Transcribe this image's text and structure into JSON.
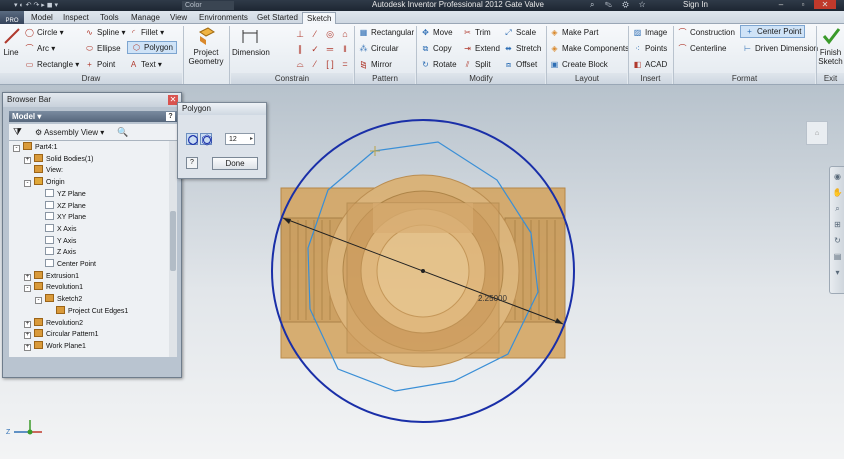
{
  "title_bar": {
    "title": "Autodesk Inventor Professional 2012   Gate Valve",
    "color_box": "Color",
    "sign_in": "Sign In"
  },
  "app_button": "PRO",
  "tabs": [
    "Model",
    "Inspect",
    "Tools",
    "Manage",
    "View",
    "Environments",
    "Get Started",
    "Sketch"
  ],
  "active_tab": "Sketch",
  "ribbon": {
    "draw": {
      "label": "Draw",
      "line": "Line",
      "circle": "Circle",
      "arc": "Arc",
      "rectangle": "Rectangle",
      "spline": "Spline",
      "ellipse": "Ellipse",
      "point": "Point",
      "fillet": "Fillet",
      "polygon": "Polygon",
      "text": "Text"
    },
    "project_geometry": "Project Geometry",
    "constrain": {
      "label": "Constrain",
      "dimension": "Dimension"
    },
    "pattern": {
      "label": "Pattern",
      "rectangular": "Rectangular",
      "circular": "Circular",
      "mirror": "Mirror"
    },
    "modify": {
      "label": "Modify",
      "move": "Move",
      "trim": "Trim",
      "scale": "Scale",
      "copy": "Copy",
      "extend": "Extend",
      "stretch": "Stretch",
      "rotate": "Rotate",
      "split": "Split",
      "offset": "Offset"
    },
    "layout": {
      "label": "Layout",
      "make_part": "Make Part",
      "make_components": "Make Components",
      "create_block": "Create Block"
    },
    "insert": {
      "label": "Insert",
      "image": "Image",
      "points": "Points",
      "acad": "ACAD"
    },
    "format": {
      "label": "Format",
      "construction": "Construction",
      "center_point": "Center Point",
      "centerline": "Centerline",
      "driven_dimension": "Driven Dimension"
    },
    "exit": {
      "label": "Exit",
      "finish_sketch": "Finish Sketch"
    }
  },
  "browser_bar": {
    "title": "Browser Bar",
    "model_label": "Model",
    "view_label": "Assembly View",
    "tree": [
      {
        "label": "Part4:1",
        "depth": 0,
        "expander": "-"
      },
      {
        "label": "Solid Bodies(1)",
        "depth": 1,
        "expander": "+"
      },
      {
        "label": "View:",
        "depth": 1,
        "expander": ""
      },
      {
        "label": "Origin",
        "depth": 1,
        "expander": "-"
      },
      {
        "label": "YZ Plane",
        "depth": 2,
        "expander": ""
      },
      {
        "label": "XZ Plane",
        "depth": 2,
        "expander": ""
      },
      {
        "label": "XY Plane",
        "depth": 2,
        "expander": ""
      },
      {
        "label": "X Axis",
        "depth": 2,
        "expander": ""
      },
      {
        "label": "Y Axis",
        "depth": 2,
        "expander": ""
      },
      {
        "label": "Z Axis",
        "depth": 2,
        "expander": ""
      },
      {
        "label": "Center Point",
        "depth": 2,
        "expander": ""
      },
      {
        "label": "Extrusion1",
        "depth": 1,
        "expander": "+"
      },
      {
        "label": "Revolution1",
        "depth": 1,
        "expander": "-"
      },
      {
        "label": "Sketch2",
        "depth": 2,
        "expander": "-"
      },
      {
        "label": "Project Cut Edges1",
        "depth": 3,
        "expander": ""
      },
      {
        "label": "Revolution2",
        "depth": 1,
        "expander": "+"
      },
      {
        "label": "Circular Pattern1",
        "depth": 1,
        "expander": "+"
      },
      {
        "label": "Work Plane1",
        "depth": 1,
        "expander": "+"
      }
    ]
  },
  "polygon_dialog": {
    "title": "Polygon",
    "sides": "12",
    "help_label": "?",
    "done_label": "Done"
  },
  "sketch": {
    "dimension_label": "2.25000"
  },
  "colors": {
    "circle": "#1a2fa8",
    "polygon": "#3a8fd6",
    "part": "#d9a55a",
    "active_tab": "#f4f7fa"
  }
}
